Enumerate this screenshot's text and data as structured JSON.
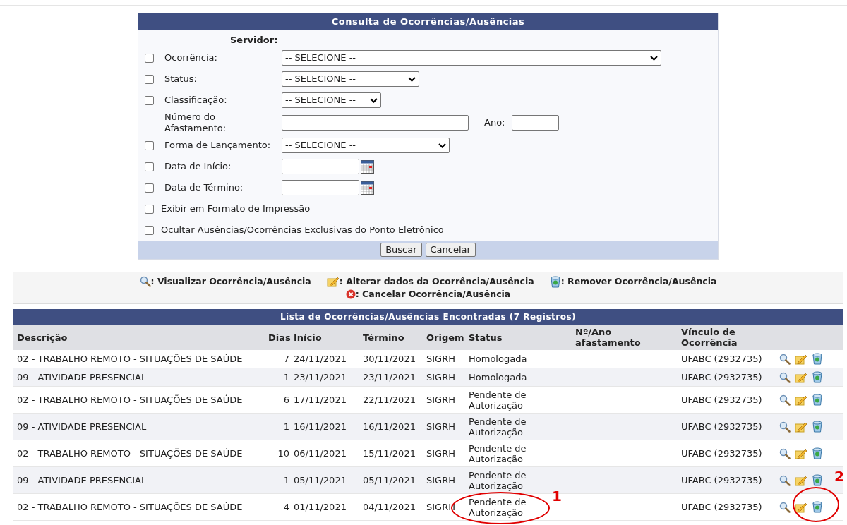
{
  "search_form": {
    "title": "Consulta de Ocorrências/Ausências",
    "server_label": "Servidor:",
    "fields": [
      {
        "kind": "select",
        "label": "Ocorrência:",
        "checked": false,
        "value": "-- SELECIONE --"
      },
      {
        "kind": "select",
        "label": "Status:",
        "checked": false,
        "value": "-- SELECIONE --"
      },
      {
        "kind": "select",
        "label": "Classificação:",
        "checked": false,
        "value": "-- SELECIONE --"
      },
      {
        "kind": "number",
        "label": "Número do Afastamento:",
        "year_label": "Ano:"
      },
      {
        "kind": "select",
        "label": "Forma de Lançamento:",
        "checked": false,
        "value": "-- SELECIONE --"
      },
      {
        "kind": "date",
        "label": "Data de Início:",
        "checked": false
      },
      {
        "kind": "date",
        "label": "Data de Término:",
        "checked": false
      },
      {
        "kind": "option",
        "label": "Exibir em Formato de Impressão",
        "checked": false
      },
      {
        "kind": "option",
        "label": "Ocultar Ausências/Ocorrências Exclusivas do Ponto Eletrônico",
        "checked": false
      }
    ],
    "buttons": [
      "Buscar",
      "Cancelar"
    ]
  },
  "legend": [
    {
      "kind": "view",
      "label": ": Visualizar Ocorrência/Ausência"
    },
    {
      "kind": "edit",
      "label": ": Alterar dados da Ocorrência/Ausência"
    },
    {
      "kind": "remove",
      "label": ": Remover Ocorrência/Ausência"
    },
    {
      "kind": "cancel",
      "label": ": Cancelar Ocorrência/Ausência"
    }
  ],
  "table": {
    "title": "Lista de Ocorrências/Ausências Encontradas (7 Registros)",
    "columns": [
      "Descrição",
      "Dias",
      "Início",
      "Término",
      "Origem",
      "Status",
      "Nº/Ano afastamento",
      "Vínculo de Ocorrência"
    ],
    "rows": [
      {
        "cells": [
          "02 - TRABALHO REMOTO - SITUAÇÕES DE SAÚDE",
          "7",
          "24/11/2021",
          "30/11/2021",
          "SIGRH",
          "Homologada",
          "",
          "UFABC (2932735)"
        ]
      },
      {
        "cells": [
          "09 - ATIVIDADE PRESENCIAL",
          "1",
          "23/11/2021",
          "23/11/2021",
          "SIGRH",
          "Homologada",
          "",
          "UFABC (2932735)"
        ]
      },
      {
        "cells": [
          "02 - TRABALHO REMOTO - SITUAÇÕES DE SAÚDE",
          "6",
          "17/11/2021",
          "22/11/2021",
          "SIGRH",
          "Pendente de Autorização",
          "",
          "UFABC (2932735)"
        ]
      },
      {
        "cells": [
          "09 - ATIVIDADE PRESENCIAL",
          "1",
          "16/11/2021",
          "16/11/2021",
          "SIGRH",
          "Pendente de Autorização",
          "",
          "UFABC (2932735)"
        ]
      },
      {
        "cells": [
          "02 - TRABALHO REMOTO - SITUAÇÕES DE SAÚDE",
          "10",
          "06/11/2021",
          "15/11/2021",
          "SIGRH",
          "Pendente de Autorização",
          "",
          "UFABC (2932735)"
        ]
      },
      {
        "cells": [
          "09 - ATIVIDADE PRESENCIAL",
          "1",
          "05/11/2021",
          "05/11/2021",
          "SIGRH",
          "Pendente de Autorização",
          "",
          "UFABC (2932735)"
        ]
      },
      {
        "cells": [
          "02 - TRABALHO REMOTO - SITUAÇÕES DE SAÚDE",
          "4",
          "01/11/2021",
          "04/11/2021",
          "SIGRH",
          "Pendente de Autorização",
          "",
          "UFABC (2932735)"
        ]
      }
    ]
  },
  "annotations": [
    {
      "label": "1"
    },
    {
      "label": "2"
    }
  ]
}
